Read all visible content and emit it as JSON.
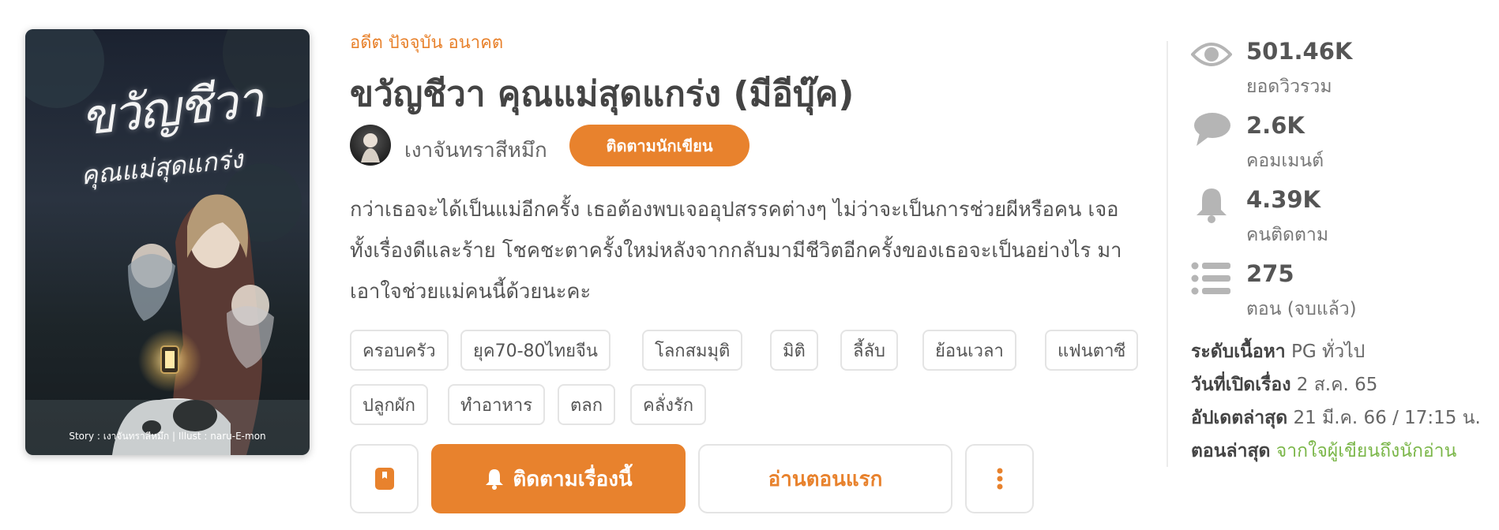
{
  "cover": {
    "title": "ขวัญชีวา",
    "subtitle": "คุณแม่สุดแกร่ง",
    "credit": "Story : เงาจันทราสีหมึก  |  Illust : naru-E-mon"
  },
  "story": {
    "genre": "อดีต ปัจจุบัน อนาคต",
    "title": "ขวัญชีวา คุณแม่สุดแกร่ง (มีอีบุ๊ค)",
    "author_name": "เงาจันทราสีหมึก",
    "follow_author_label": "ติดตามนักเขียน",
    "synopsis": "กว่าเธอจะได้เป็นแม่อีกครั้ง เธอต้องพบเจออุปสรรคต่างๆ ไม่ว่าจะเป็นการช่วยผีหรือคน เจอทั้งเรื่องดีและร้าย โชคชะตาครั้งใหม่หลังจากกลับมามีชีวิตอีกครั้งของเธอจะเป็นอย่างไร มาเอาใจช่วยแม่คนนี้ด้วยนะคะ",
    "tags": [
      "ครอบครัว",
      "ยุค70-80ไทยจีน",
      "โลกสมมุติ",
      "มิติ",
      "ลี้ลับ",
      "ย้อนเวลา",
      "แฟนตาซี",
      "ปลูกผัก",
      "ทำอาหาร",
      "ตลก",
      "คลั่งรัก"
    ]
  },
  "actions": {
    "follow_story_label": "ติดตามเรื่องนี้",
    "read_first_label": "อ่านตอนแรก"
  },
  "stats": {
    "views_value": "501.46K",
    "views_label": "ยอดวิวรวม",
    "comments_value": "2.6K",
    "comments_label": "คอมเมนต์",
    "followers_value": "4.39K",
    "followers_label": "คนติดตาม",
    "episodes_value": "275",
    "episodes_label": "ตอน (จบแล้ว)"
  },
  "meta": {
    "rating_label": "ระดับเนื้อหา",
    "rating_value": "PG ทั่วไป",
    "opened_label": "วันที่เปิดเรื่อง",
    "opened_value": "2 ส.ค. 65",
    "updated_label": "อัปเดตล่าสุด",
    "updated_value": "21 มี.ค. 66 / 17:15 น.",
    "latest_label": "ตอนล่าสุด",
    "latest_value": "จากใจผู้เขียนถึงนักอ่าน"
  },
  "colors": {
    "accent": "#e8822d",
    "link_green": "#7ab648",
    "border": "#e4e4e4"
  },
  "icons": [
    "eye-icon",
    "comment-icon",
    "bell-icon",
    "list-icon",
    "bookmark-icon",
    "more-vertical-icon"
  ]
}
